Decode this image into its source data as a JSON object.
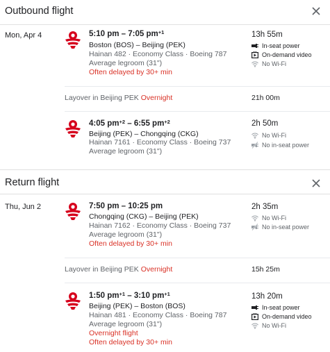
{
  "outbound": {
    "title": "Outbound flight",
    "date": "Mon, Apr 4",
    "legs": [
      {
        "time_depart": "5:10 pm",
        "sep": " – ",
        "time_arrive": "7:05 pm",
        "arrive_offset": "+1",
        "route": "Boston (BOS) – Beijing (PEK)",
        "flight_info": "Hainan 482 · Economy Class · Boeing 787",
        "legroom": "Average legroom (31\")",
        "notes": [
          "Often delayed by 30+ min"
        ],
        "duration": "13h 55m",
        "amenities": [
          {
            "icon": "power-icon",
            "label": "In-seat power",
            "on": true
          },
          {
            "icon": "video-icon",
            "label": "On-demand video",
            "on": true
          },
          {
            "icon": "no-wifi-icon",
            "label": "No Wi-Fi",
            "on": false
          }
        ]
      },
      {
        "time_depart": "4:05 pm",
        "depart_offset": "+2",
        "sep": " – ",
        "time_arrive": "6:55 pm",
        "arrive_offset": "+2",
        "route": "Beijing (PEK) – Chongqing (CKG)",
        "flight_info": "Hainan 7161 · Economy Class · Boeing 737",
        "legroom": "Average legroom (31\")",
        "notes": [],
        "duration": "2h 50m",
        "amenities": [
          {
            "icon": "no-wifi-icon",
            "label": "No Wi-Fi",
            "on": false
          },
          {
            "icon": "no-power-icon",
            "label": "No in-seat power",
            "on": false
          }
        ]
      }
    ],
    "layover": {
      "text": "Layover in Beijing PEK ",
      "flag": "Overnight",
      "duration": "21h 00m"
    }
  },
  "return": {
    "title": "Return flight",
    "date": "Thu, Jun 2",
    "legs": [
      {
        "time_depart": "7:50 pm",
        "sep": " – ",
        "time_arrive": "10:25 pm",
        "route": "Chongqing (CKG) – Beijing (PEK)",
        "flight_info": "Hainan 7162 · Economy Class · Boeing 737",
        "legroom": "Average legroom (31\")",
        "notes": [
          "Often delayed by 30+ min"
        ],
        "duration": "2h 35m",
        "amenities": [
          {
            "icon": "no-wifi-icon",
            "label": "No Wi-Fi",
            "on": false
          },
          {
            "icon": "no-power-icon",
            "label": "No in-seat power",
            "on": false
          }
        ]
      },
      {
        "time_depart": "1:50 pm",
        "depart_offset": "+1",
        "sep": " – ",
        "time_arrive": "3:10 pm",
        "arrive_offset": "+1",
        "route": "Beijing (PEK) – Boston (BOS)",
        "flight_info": "Hainan 481 · Economy Class · Boeing 787",
        "legroom": "Average legroom (31\")",
        "notes": [
          "Overnight flight",
          "Often delayed by 30+ min"
        ],
        "duration": "13h 20m",
        "amenities": [
          {
            "icon": "power-icon",
            "label": "In-seat power",
            "on": true
          },
          {
            "icon": "video-icon",
            "label": "On-demand video",
            "on": true
          },
          {
            "icon": "no-wifi-icon",
            "label": "No Wi-Fi",
            "on": false
          }
        ]
      }
    ],
    "layover": {
      "text": "Layover in Beijing PEK ",
      "flag": "Overnight",
      "duration": "15h 25m"
    }
  },
  "colors": {
    "warn": "#d93025",
    "muted": "#5f6368",
    "text": "#202124",
    "brand": "#d6001c"
  }
}
